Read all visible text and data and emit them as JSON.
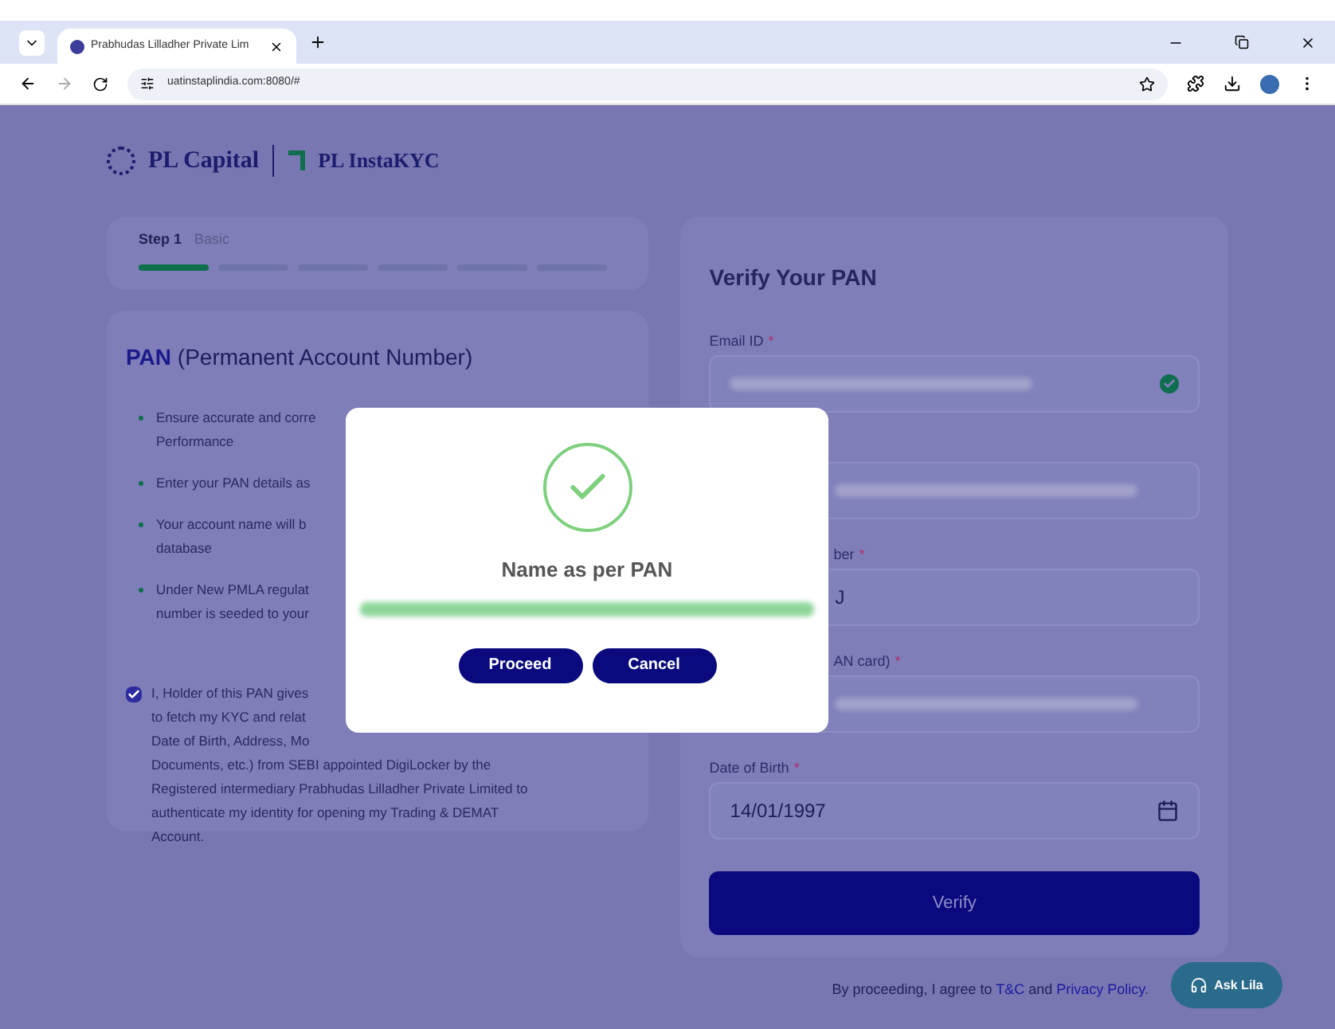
{
  "browser": {
    "tab_title": "Prabhudas Lilladher Private Lim",
    "url": "uatinstaplindia.com:8080/#"
  },
  "logo": {
    "brand": "PL Capital",
    "product": "PL InstaKYC"
  },
  "steps": {
    "label": "Step 1",
    "name": "Basic",
    "segments": [
      {
        "done": true
      },
      {
        "done": false
      },
      {
        "done": false
      },
      {
        "done": false
      },
      {
        "done": false
      },
      {
        "done": false
      }
    ]
  },
  "pan_info": {
    "title_bold": "PAN",
    "title_rest": "(Permanent Account Number)",
    "bullets": [
      {
        "lines": [
          "Ensure accurate and corre",
          "Performance"
        ]
      },
      {
        "lines": [
          "Enter your PAN details as"
        ]
      },
      {
        "lines": [
          "Your account name will b",
          "database"
        ]
      },
      {
        "lines": [
          "Under New PMLA regulat",
          "number is seeded to your"
        ]
      }
    ],
    "consent": {
      "checked": true,
      "lines": [
        "I, Holder of this PAN gives",
        "to fetch my KYC and relat",
        "Date of Birth, Address, Mo",
        "Documents, etc.) from SEBI appointed DigiLocker by the",
        "Registered intermediary Prabhudas Lilladher Private Limited to",
        "authenticate my identity for opening my Trading & DEMAT",
        "Account."
      ]
    }
  },
  "verify_form": {
    "title": "Verify Your PAN",
    "fields": [
      {
        "kind": "blurred",
        "label": "Email ID",
        "required_mark": "*",
        "verified": true
      },
      {
        "kind": "blurred",
        "verified": false
      },
      {
        "kind": "text",
        "label": "ber",
        "required_mark": "*",
        "value": "J",
        "verified": false
      },
      {
        "kind": "blurred",
        "label": "AN card)",
        "required_mark": "*",
        "verified": false
      },
      {
        "kind": "date",
        "label": "Date of Birth",
        "required_mark": "*",
        "value": "14/01/1997",
        "verified": false
      }
    ],
    "submit": "Verify"
  },
  "footer": {
    "before": "By proceeding, I agree to ",
    "terms": "T&C",
    "middle": " and ",
    "privacy": "Privacy Policy",
    "after": "."
  },
  "help_button": "Ask Lila",
  "modal": {
    "title": "Name as per PAN",
    "name_redacted": true,
    "buttons": [
      "Proceed",
      "Cancel"
    ]
  }
}
